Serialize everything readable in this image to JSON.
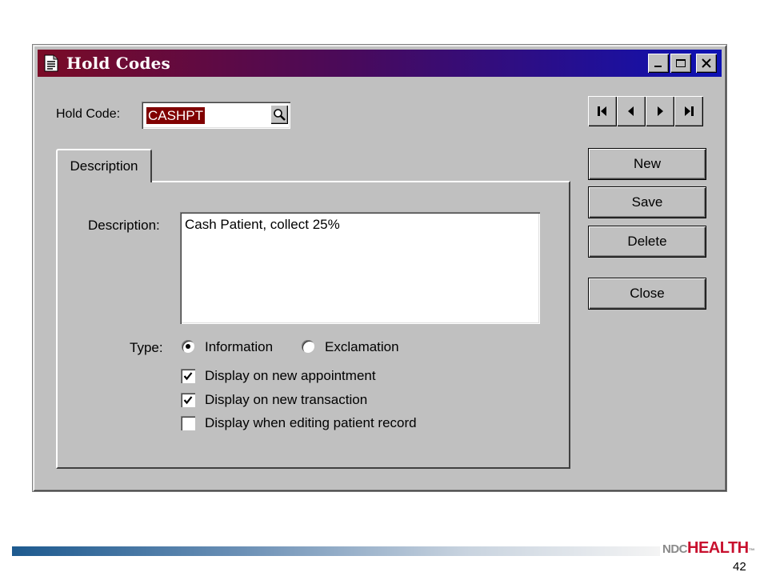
{
  "window": {
    "title": "Hold Codes",
    "controls": {
      "minimize": "minimize",
      "maximize": "maximize",
      "close": "close"
    }
  },
  "hold_code": {
    "label": "Hold Code:",
    "label_underline_char": "C",
    "value": "CASHPT"
  },
  "nav_buttons": [
    "first-record",
    "previous-record",
    "next-record",
    "last-record"
  ],
  "actions": {
    "new": "New",
    "save": "Save",
    "delete": "Delete",
    "close": "Close"
  },
  "tabs": [
    {
      "label": "Description",
      "active": true
    }
  ],
  "form": {
    "description_label": "Description:",
    "description_value": "Cash Patient, collect 25%",
    "type_label": "Type:",
    "type_options": [
      {
        "label": "Information",
        "selected": true
      },
      {
        "label": "Exclamation",
        "selected": false
      }
    ],
    "checkboxes": [
      {
        "label": "Display on new appointment",
        "checked": true
      },
      {
        "label": "Display on new transaction",
        "checked": true
      },
      {
        "label": "Display when editing patient record",
        "checked": false
      }
    ]
  },
  "footer": {
    "logo_ndc": "NDC",
    "logo_health": "HEALTH",
    "logo_tm": "™",
    "page_number": "42"
  },
  "colors": {
    "title_gradient_start": "#7a0b26",
    "title_gradient_end": "#0d12b4",
    "selection": "#800000",
    "face": "#c0c0c0",
    "brand_red": "#c8102e"
  }
}
